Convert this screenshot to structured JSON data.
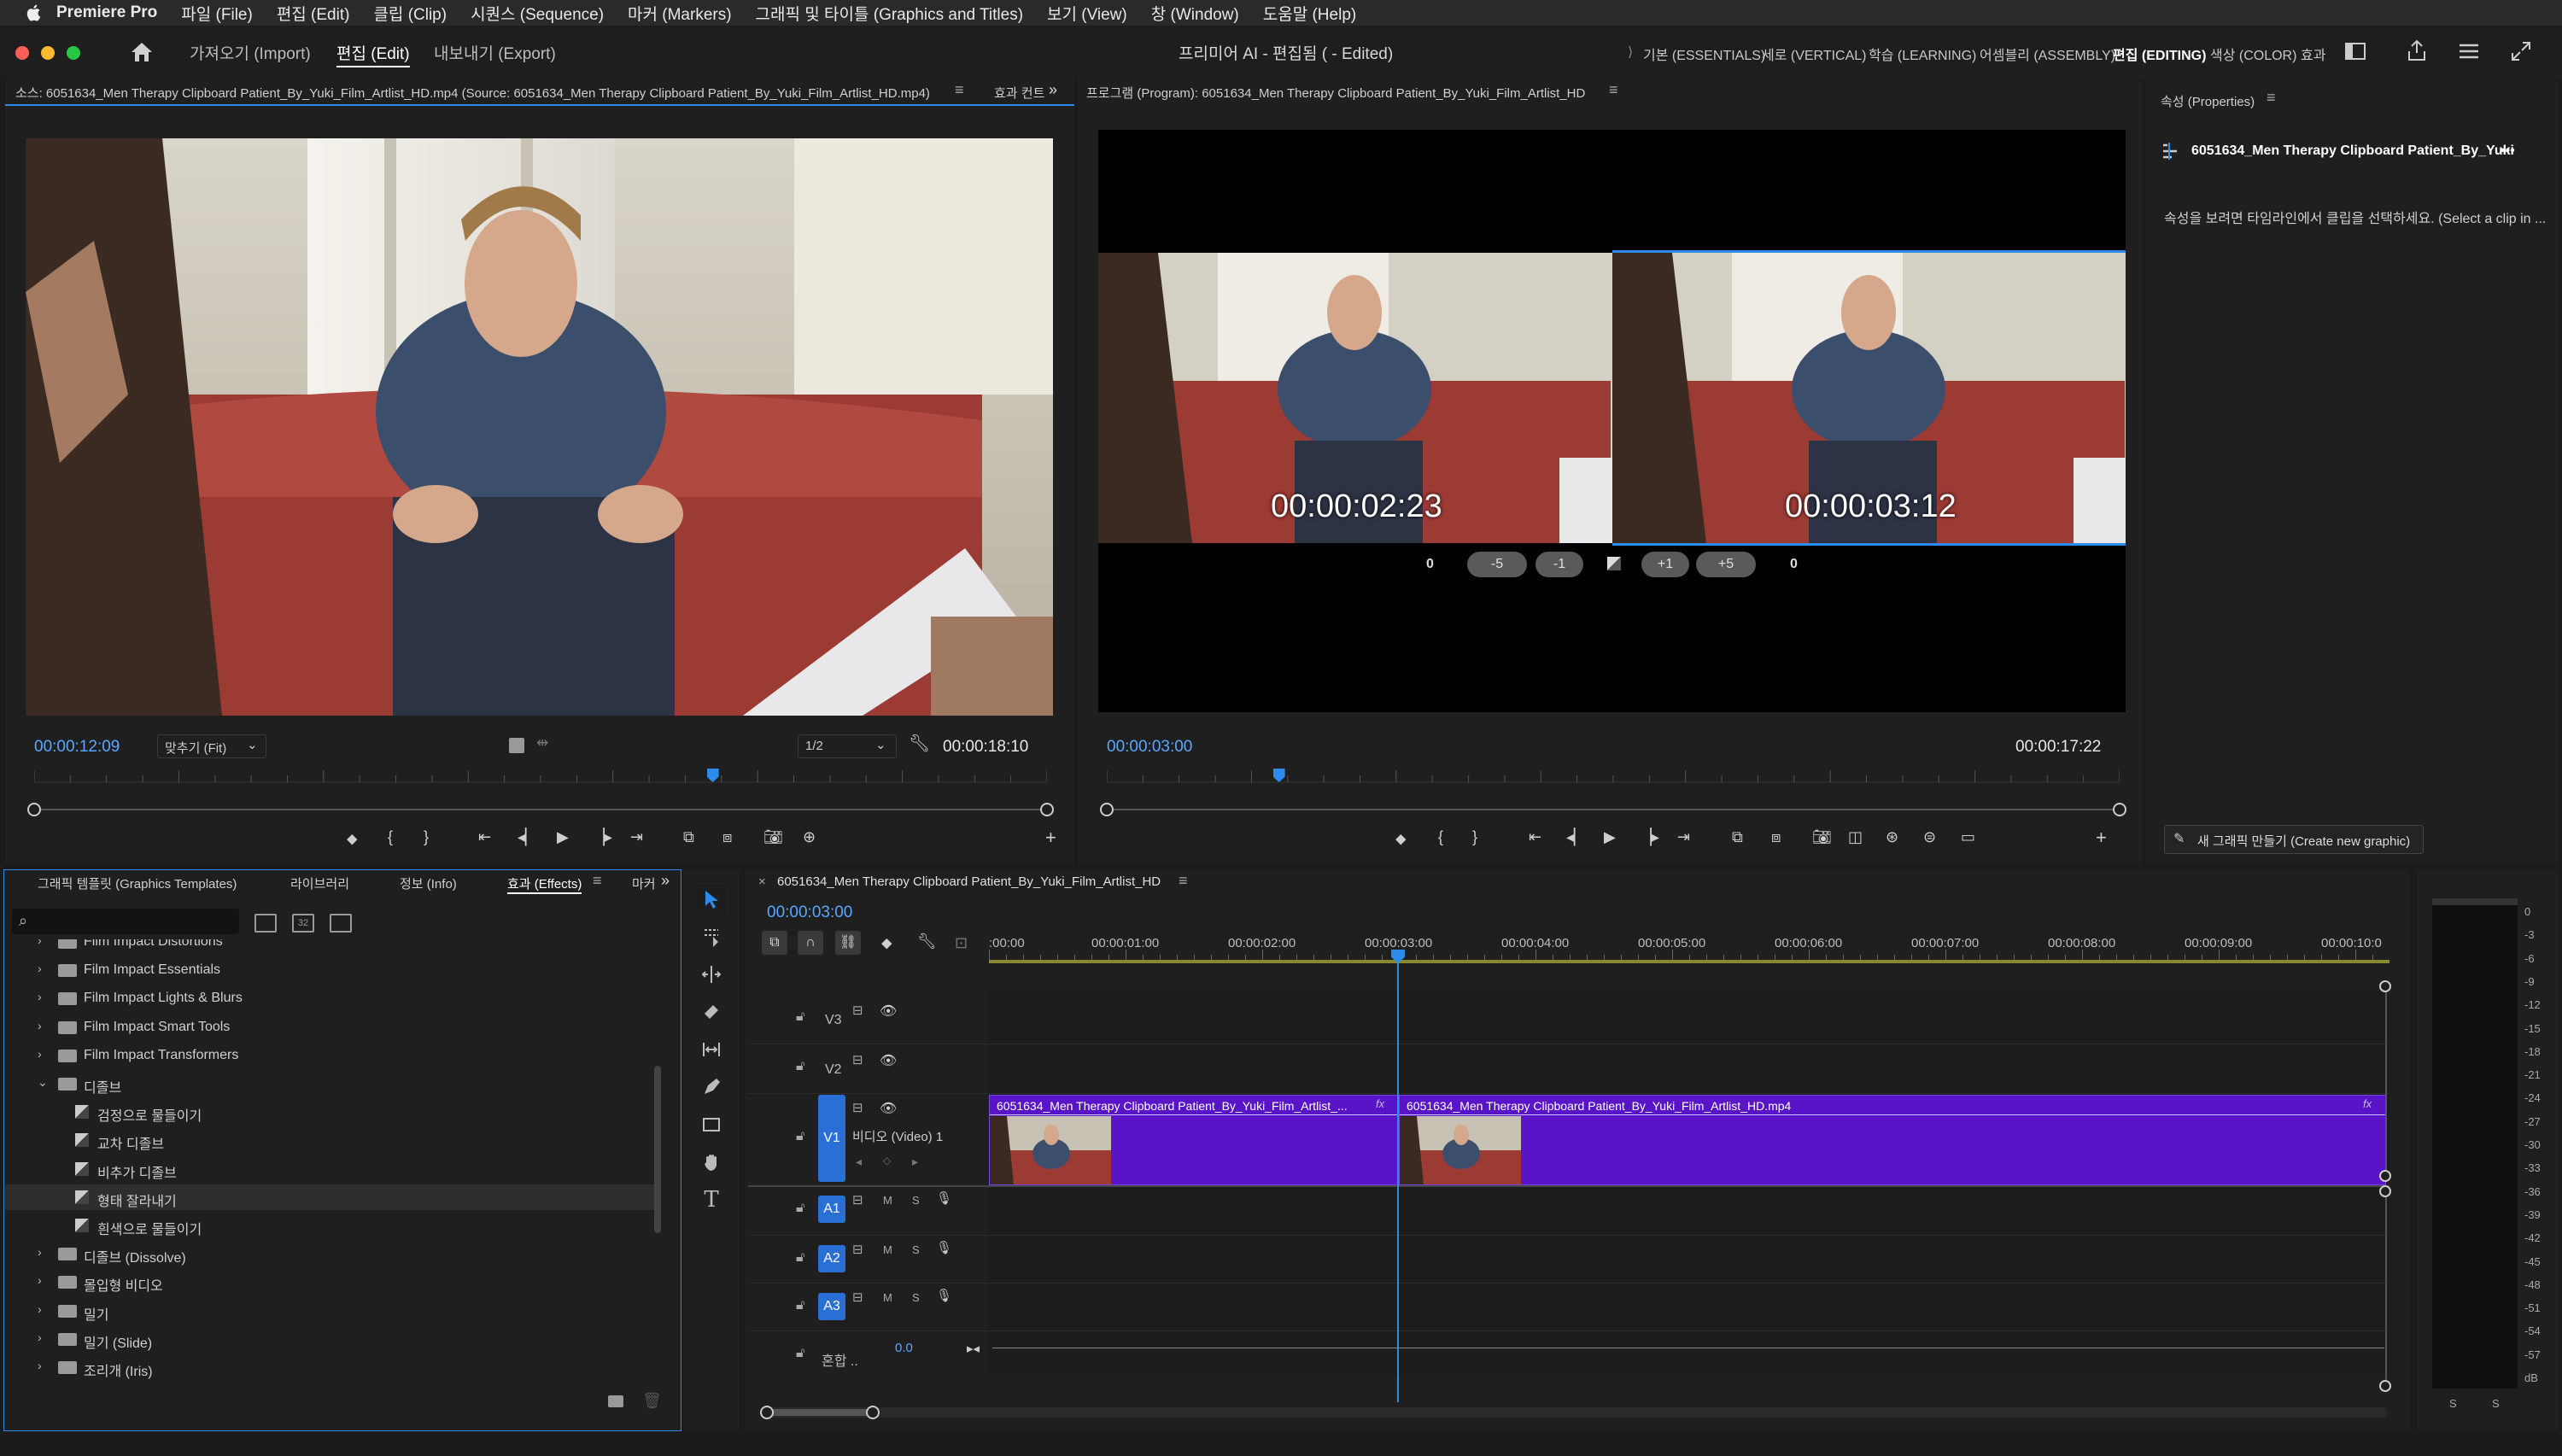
{
  "colors": {
    "accent_blue": "#2d8ceb",
    "timecode_blue": "#5aa7ff",
    "clip_purple": "#5a14c8",
    "track_blue": "#2a6fd6"
  },
  "menubar": {
    "app": "Premiere Pro",
    "items": [
      "파일 (File)",
      "편집 (Edit)",
      "클립 (Clip)",
      "시퀀스 (Sequence)",
      "마커 (Markers)",
      "그래픽 및 타이틀 (Graphics and Titles)",
      "보기 (View)",
      "창 (Window)",
      "도움말 (Help)"
    ]
  },
  "header": {
    "tabs": {
      "import": "가져오기 (Import)",
      "edit": "편집 (Edit)",
      "export": "내보내기 (Export)"
    },
    "title": "프리미어 AI - 편집됨 ( - Edited)",
    "workspaces": [
      "기본 (ESSENTIALS)",
      "세로 (VERTICAL)",
      "학습 (LEARNING)",
      "어셈블리 (ASSEMBLY)",
      "편집 (EDITING)",
      "색상 (COLOR)",
      "효과"
    ],
    "active_workspace": "편집 (EDITING)"
  },
  "source": {
    "title": "소스: 6051634_Men Therapy Clipboard Patient_By_Yuki_Film_Artlist_HD.mp4 (Source: 6051634_Men Therapy Clipboard Patient_By_Yuki_Film_Artlist_HD.mp4)",
    "next_tab": "효과 컨트",
    "timecode": "00:00:12:09",
    "zoom": "맞추기 (Fit)",
    "resolution": "1/2",
    "duration": "00:00:18:10",
    "playhead_fraction": 0.67
  },
  "program": {
    "title": "프로그램 (Program): 6051634_Men Therapy Clipboard Patient_By_Yuki_Film_Artlist_HD",
    "left_tc": "00:00:02:23",
    "right_tc": "00:00:03:12",
    "trim": {
      "left": "0",
      "m5": "-5",
      "m1": "-1",
      "p1": "+1",
      "p5": "+5",
      "right": "0"
    },
    "timecode": "00:00:03:00",
    "duration": "00:00:17:22",
    "playhead_fraction": 0.17
  },
  "properties": {
    "title": "속성 (Properties)",
    "clip": "6051634_Men Therapy Clipboard Patient_By_Yuki",
    "hint": "속성을 보려면 타임라인에서 클립을 선택하세요. (Select a clip in ...",
    "new_graphic": "새 그래픽 만들기 (Create new graphic)"
  },
  "effects_panel": {
    "tabs": [
      "그래픽 템플릿 (Graphics Templates)",
      "라이브러리",
      "정보 (Info)",
      "효과 (Effects)",
      "마커"
    ],
    "active_tab": "효과 (Effects)",
    "items": [
      {
        "label": "Film Impact Distortions",
        "type": "folder",
        "level": 1,
        "open": false
      },
      {
        "label": "Film Impact Essentials",
        "type": "folder",
        "level": 1,
        "open": false
      },
      {
        "label": "Film Impact Lights & Blurs",
        "type": "folder",
        "level": 1,
        "open": false
      },
      {
        "label": "Film Impact Smart Tools",
        "type": "folder",
        "level": 1,
        "open": false
      },
      {
        "label": "Film Impact Transformers",
        "type": "folder",
        "level": 1,
        "open": false
      },
      {
        "label": "디졸브",
        "type": "folder",
        "level": 1,
        "open": true
      },
      {
        "label": "검정으로 물들이기",
        "type": "effect",
        "level": 2
      },
      {
        "label": "교차 디졸브",
        "type": "effect",
        "level": 2
      },
      {
        "label": "비추가 디졸브",
        "type": "effect",
        "level": 2
      },
      {
        "label": "형태 잘라내기",
        "type": "effect",
        "level": 2,
        "selected": true
      },
      {
        "label": "흰색으로 물들이기",
        "type": "effect",
        "level": 2
      },
      {
        "label": "디졸브 (Dissolve)",
        "type": "folder",
        "level": 1,
        "open": false
      },
      {
        "label": "몰입형 비디오",
        "type": "folder",
        "level": 1,
        "open": false
      },
      {
        "label": "밀기",
        "type": "folder",
        "level": 1,
        "open": false
      },
      {
        "label": "밀기 (Slide)",
        "type": "folder",
        "level": 1,
        "open": false
      },
      {
        "label": "조리개 (Iris)",
        "type": "folder",
        "level": 1,
        "open": false
      }
    ]
  },
  "timeline": {
    "tab": "6051634_Men Therapy Clipboard Patient_By_Yuki_Film_Artlist_HD",
    "timecode": "00:00:03:00",
    "ruler": [
      ":00:00",
      "00:00:01:00",
      "00:00:02:00",
      "00:00:03:00",
      "00:00:04:00",
      "00:00:05:00",
      "00:00:06:00",
      "00:00:07:00",
      "00:00:08:00",
      "00:00:09:00",
      "00:00:10:0"
    ],
    "tracks": {
      "v3": "V3",
      "v2": "V2",
      "v1": "V1",
      "video1": "비디오 (Video) 1",
      "a1": "A1",
      "a2": "A2",
      "a3": "A3",
      "mix": "혼합 ..",
      "mix_value": "0.0",
      "m": "M",
      "s": "S"
    },
    "clips": [
      {
        "name": "6051634_Men Therapy Clipboard Patient_By_Yuki_Film_Artlist_..."
      },
      {
        "name": "6051634_Men Therapy Clipboard Patient_By_Yuki_Film_Artlist_HD.mp4"
      }
    ],
    "fx_label": "fx"
  },
  "meter": {
    "scale": [
      "0",
      "-3",
      "-6",
      "-9",
      "-12",
      "-15",
      "-18",
      "-21",
      "-24",
      "-27",
      "-30",
      "-33",
      "-36",
      "-39",
      "-42",
      "-45",
      "-48",
      "-51",
      "-54",
      "-57",
      "dB"
    ],
    "solo": [
      "S",
      "S"
    ]
  }
}
